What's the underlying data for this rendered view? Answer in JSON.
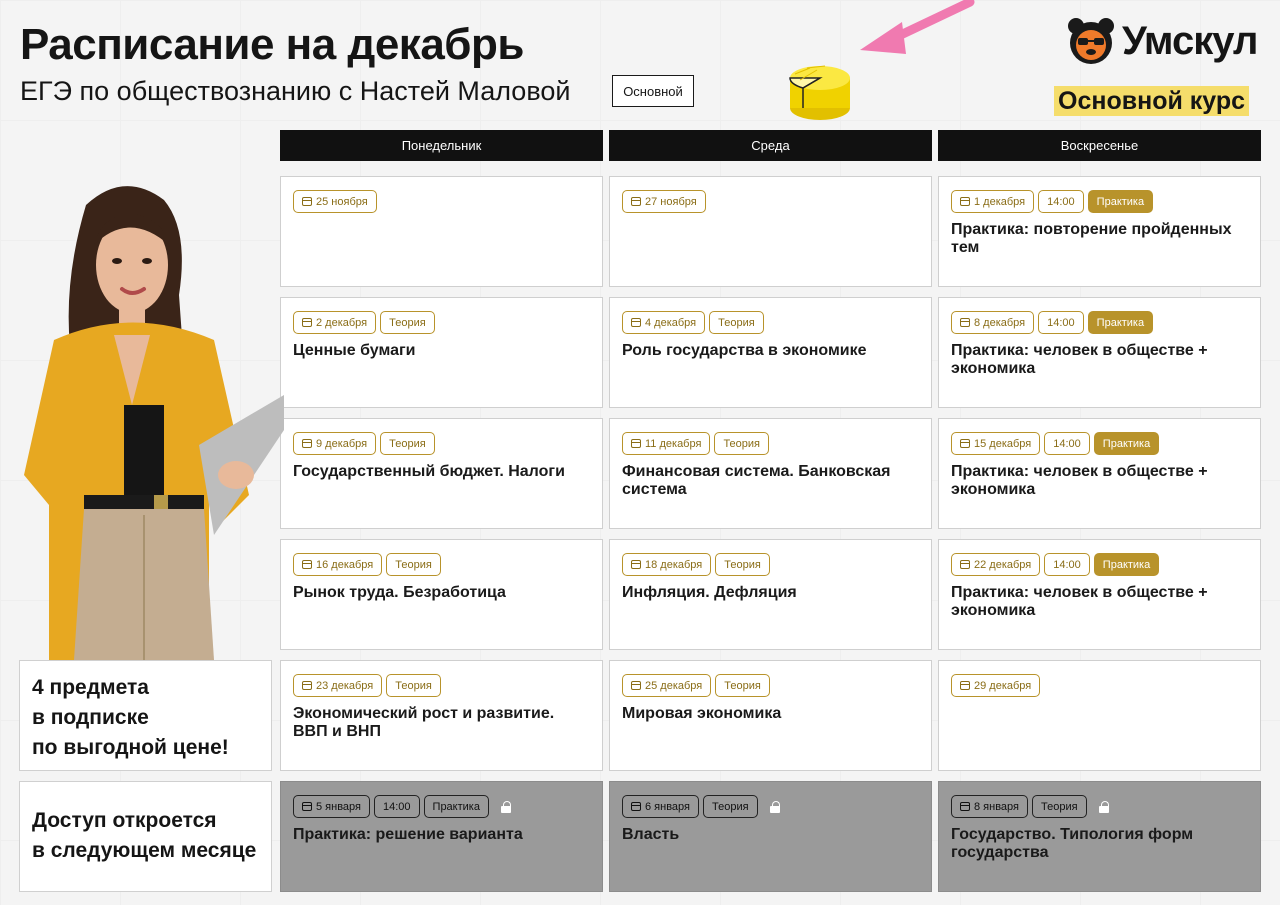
{
  "header": {
    "title": "Расписание на декабрь",
    "subtitle": "ЕГЭ по обществознанию с Настей Маловой",
    "level_badge": "Основной"
  },
  "brand": {
    "logo_text": "Умскул",
    "course_label": "Основной курс",
    "accent_color": "#b8932b",
    "highlight_color": "#f5dd6b",
    "arrow_color": "#f07ab0"
  },
  "columns": [
    "Понедельник",
    "Среда",
    "Воскресенье"
  ],
  "rows": [
    [
      {
        "tags": [
          {
            "text": "25 ноября",
            "kind": "date"
          }
        ],
        "title": ""
      },
      {
        "tags": [
          {
            "text": "27 ноября",
            "kind": "date"
          }
        ],
        "title": ""
      },
      {
        "tags": [
          {
            "text": "1 декабря",
            "kind": "date"
          },
          {
            "text": "14:00",
            "kind": "time"
          },
          {
            "text": "Практика",
            "kind": "practice"
          }
        ],
        "title": "Практика: повторение пройденных тем"
      }
    ],
    [
      {
        "tags": [
          {
            "text": "2 декабря",
            "kind": "date"
          },
          {
            "text": "Теория",
            "kind": "theory"
          }
        ],
        "title": "Ценные бумаги"
      },
      {
        "tags": [
          {
            "text": "4 декабря",
            "kind": "date"
          },
          {
            "text": "Теория",
            "kind": "theory"
          }
        ],
        "title": "Роль государства в экономике"
      },
      {
        "tags": [
          {
            "text": "8 декабря",
            "kind": "date"
          },
          {
            "text": "14:00",
            "kind": "time"
          },
          {
            "text": "Практика",
            "kind": "practice"
          }
        ],
        "title": "Практика: человек в обществе + экономика"
      }
    ],
    [
      {
        "tags": [
          {
            "text": "9 декабря",
            "kind": "date"
          },
          {
            "text": "Теория",
            "kind": "theory"
          }
        ],
        "title": "Государственный бюджет. Налоги"
      },
      {
        "tags": [
          {
            "text": "11 декабря",
            "kind": "date"
          },
          {
            "text": "Теория",
            "kind": "theory"
          }
        ],
        "title": "Финансовая система. Банковская система"
      },
      {
        "tags": [
          {
            "text": "15 декабря",
            "kind": "date"
          },
          {
            "text": "14:00",
            "kind": "time"
          },
          {
            "text": "Практика",
            "kind": "practice"
          }
        ],
        "title": "Практика: человек в обществе + экономика"
      }
    ],
    [
      {
        "tags": [
          {
            "text": "16 декабря",
            "kind": "date"
          },
          {
            "text": "Теория",
            "kind": "theory"
          }
        ],
        "title": "Рынок труда. Безработица"
      },
      {
        "tags": [
          {
            "text": "18 декабря",
            "kind": "date"
          },
          {
            "text": "Теория",
            "kind": "theory"
          }
        ],
        "title": "Инфляция. Дефляция"
      },
      {
        "tags": [
          {
            "text": "22 декабря",
            "kind": "date"
          },
          {
            "text": "14:00",
            "kind": "time"
          },
          {
            "text": "Практика",
            "kind": "practice"
          }
        ],
        "title": "Практика: человек в обществе + экономика"
      }
    ],
    [
      {
        "tags": [
          {
            "text": "23 декабря",
            "kind": "date"
          },
          {
            "text": "Теория",
            "kind": "theory"
          }
        ],
        "title": "Экономический рост и развитие. ВВП и ВНП"
      },
      {
        "tags": [
          {
            "text": "25 декабря",
            "kind": "date"
          },
          {
            "text": "Теория",
            "kind": "theory"
          }
        ],
        "title": "Мировая экономика"
      },
      {
        "tags": [
          {
            "text": "29 декабря",
            "kind": "date"
          }
        ],
        "title": ""
      }
    ],
    [
      {
        "tags": [
          {
            "text": "5 января",
            "kind": "date"
          },
          {
            "text": "14:00",
            "kind": "time"
          },
          {
            "text": "Практика",
            "kind": "practice"
          }
        ],
        "title": "Практика: решение варианта",
        "locked": true
      },
      {
        "tags": [
          {
            "text": "6 января",
            "kind": "date"
          },
          {
            "text": "Теория",
            "kind": "theory"
          }
        ],
        "title": "Власть",
        "locked": true
      },
      {
        "tags": [
          {
            "text": "8 января",
            "kind": "date"
          },
          {
            "text": "Теория",
            "kind": "theory"
          }
        ],
        "title": "Государство. Типология форм государства",
        "locked": true
      }
    ]
  ],
  "promo": {
    "subscription": "4 предмета\nв подписке\nпо выгодной цене!",
    "next_month": "Доступ откроется\nв следующем месяце"
  }
}
